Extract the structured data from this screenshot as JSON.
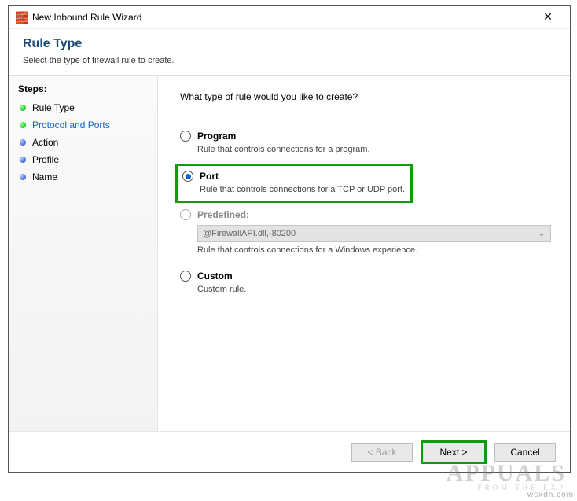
{
  "titlebar": {
    "icon": "🧱",
    "title": "New Inbound Rule Wizard",
    "close_label": "✕"
  },
  "header": {
    "title": "Rule Type",
    "subtitle": "Select the type of firewall rule to create."
  },
  "sidebar": {
    "heading": "Steps:",
    "items": [
      {
        "label": "Rule Type",
        "dot": "green",
        "current": false
      },
      {
        "label": "Protocol and Ports",
        "dot": "green",
        "current": true
      },
      {
        "label": "Action",
        "dot": "blue",
        "current": false
      },
      {
        "label": "Profile",
        "dot": "blue",
        "current": false
      },
      {
        "label": "Name",
        "dot": "blue",
        "current": false
      }
    ]
  },
  "content": {
    "prompt": "What type of rule would you like to create?",
    "options": {
      "program": {
        "label": "Program",
        "desc": "Rule that controls connections for a program."
      },
      "port": {
        "label": "Port",
        "desc": "Rule that controls connections for a TCP or UDP port."
      },
      "predefined": {
        "label": "Predefined:",
        "select_value": "@FirewallAPI.dll,-80200",
        "desc": "Rule that controls connections for a Windows experience."
      },
      "custom": {
        "label": "Custom",
        "desc": "Custom rule."
      }
    }
  },
  "footer": {
    "back": "< Back",
    "next": "Next >",
    "cancel": "Cancel"
  },
  "watermark": "wsxdn.com",
  "brand": {
    "big": "APPUALS",
    "sub": "FROM   THE   EXP"
  }
}
